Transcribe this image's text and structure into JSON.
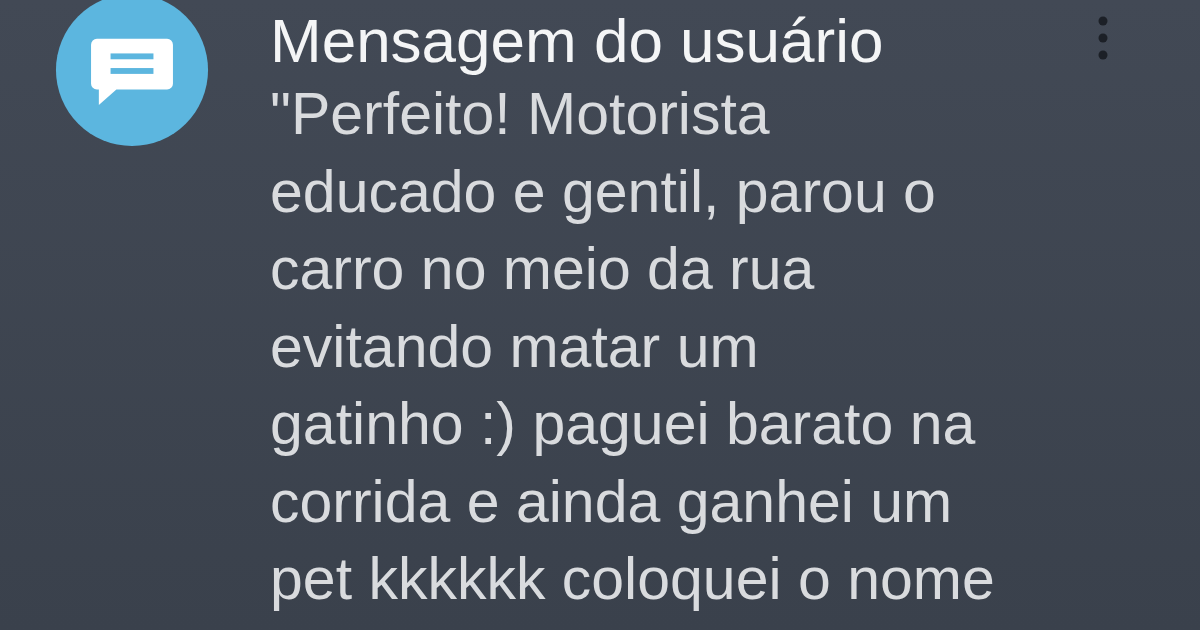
{
  "notification": {
    "title": "Mensagem do usuário",
    "message_lines": [
      "\"Perfeito! Motorista",
      "educado e gentil, parou o",
      "carro no meio da rua",
      "evitando matar um",
      "gatinho :) paguei barato na",
      "corrida e ainda ganhei um",
      "pet kkkkkk coloquei o nome"
    ]
  }
}
